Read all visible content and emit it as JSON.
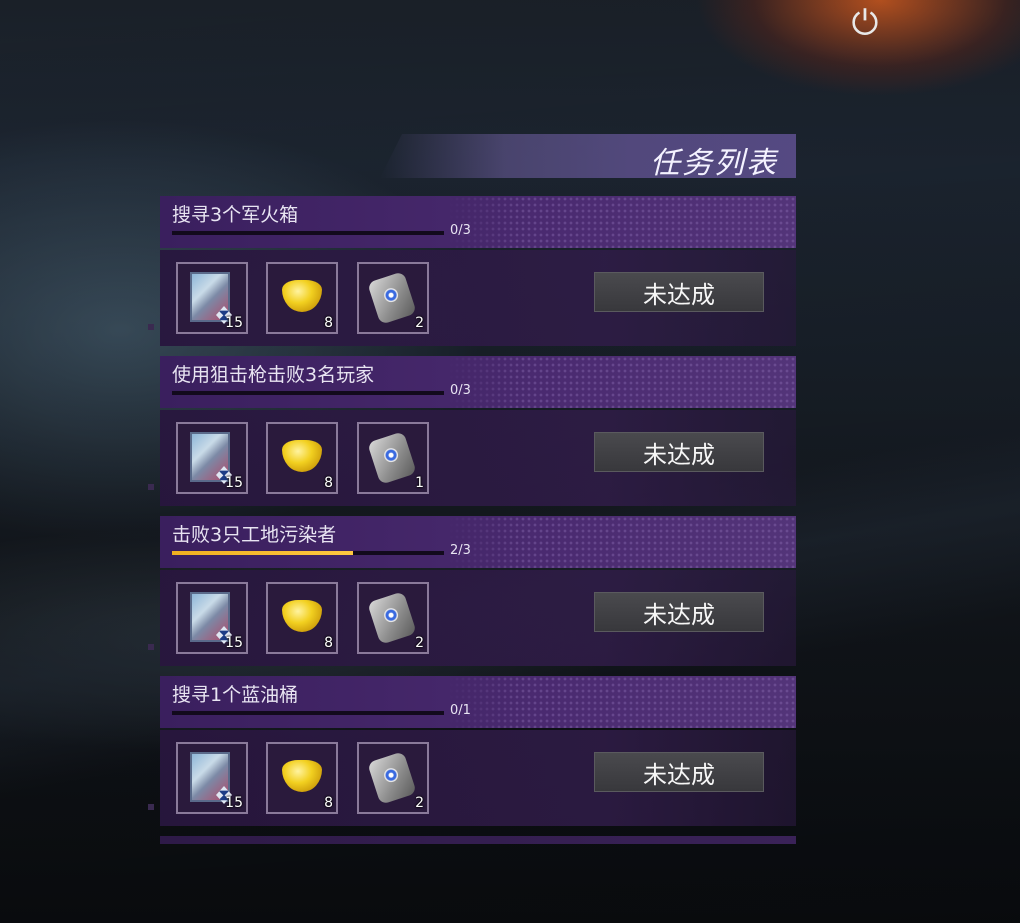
{
  "header": {
    "power_icon": "power-icon",
    "title": "任务列表"
  },
  "colors": {
    "panel_purple": "#3a1f5e",
    "progress_gold": "#f0b020",
    "button_gray": "#404044"
  },
  "quests": [
    {
      "name": "搜寻3个军火箱",
      "progress_text": "0/3",
      "progress_fraction": 0.0,
      "status": "未达成",
      "rewards": [
        {
          "icon": "card-icon",
          "count": "15"
        },
        {
          "icon": "gold-ingot-icon",
          "count": "8"
        },
        {
          "icon": "dog-tag-icon",
          "count": "2"
        }
      ]
    },
    {
      "name": "使用狙击枪击败3名玩家",
      "progress_text": "0/3",
      "progress_fraction": 0.0,
      "status": "未达成",
      "rewards": [
        {
          "icon": "card-icon",
          "count": "15"
        },
        {
          "icon": "gold-ingot-icon",
          "count": "8"
        },
        {
          "icon": "dog-tag-icon",
          "count": "1"
        }
      ]
    },
    {
      "name": "击败3只工地污染者",
      "progress_text": "2/3",
      "progress_fraction": 0.6667,
      "status": "未达成",
      "rewards": [
        {
          "icon": "card-icon",
          "count": "15"
        },
        {
          "icon": "gold-ingot-icon",
          "count": "8"
        },
        {
          "icon": "dog-tag-icon",
          "count": "2"
        }
      ]
    },
    {
      "name": "搜寻1个蓝油桶",
      "progress_text": "0/1",
      "progress_fraction": 0.0,
      "status": "未达成",
      "rewards": [
        {
          "icon": "card-icon",
          "count": "15"
        },
        {
          "icon": "gold-ingot-icon",
          "count": "8"
        },
        {
          "icon": "dog-tag-icon",
          "count": "2"
        }
      ]
    }
  ]
}
